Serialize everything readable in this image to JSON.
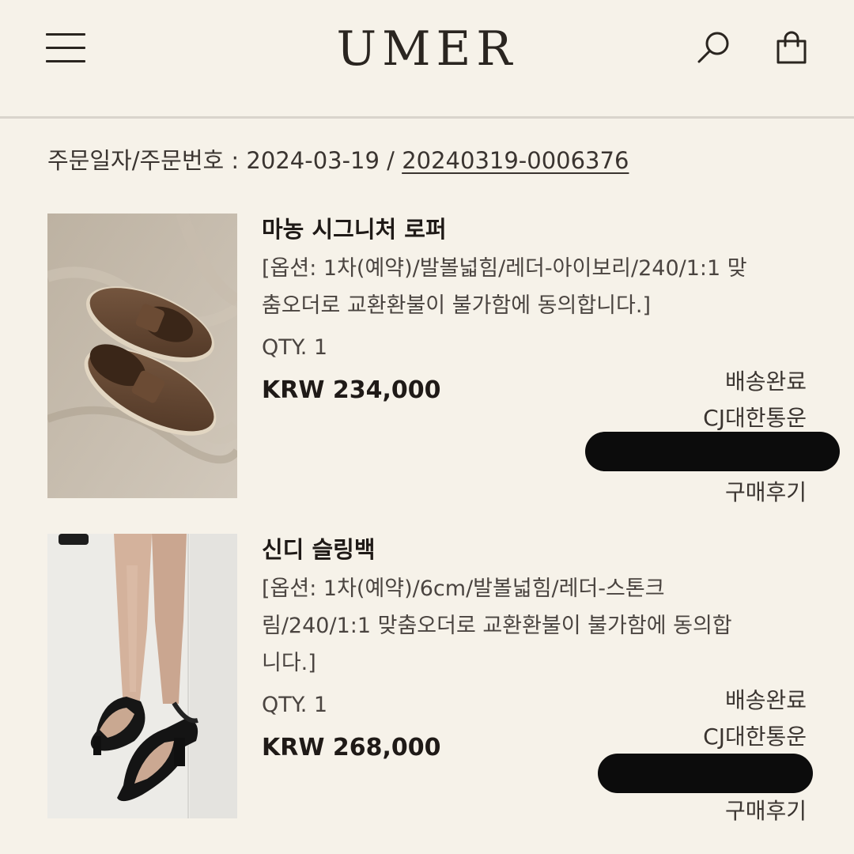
{
  "header": {
    "logo": "UMER",
    "icons": {
      "menu": "menu-icon",
      "search": "search-icon",
      "cart": "shopping-bag-icon"
    }
  },
  "order": {
    "label": "주문일자/주문번호 : ",
    "date": "2024-03-19",
    "separator": " / ",
    "number": "20240319-0006376"
  },
  "items": [
    {
      "name": "마농 시그니처 로퍼",
      "option_line1": "[옵션: 1차(예약)/발볼넓힘/레더-아이보리/240/1:1 맞",
      "option_line2": "춤오더로 교환환불이 불가함에 동의합니다.]",
      "option_line3": "",
      "qty": "QTY. 1",
      "price": "KRW 234,000",
      "status": "배송완료",
      "carrier": "CJ대한통운",
      "review": "구매후기"
    },
    {
      "name": "신디 슬링백",
      "option_line1": "[옵션: 1차(예약)/6cm/발볼넓힘/레더-스톤크",
      "option_line2": "림/240/1:1 맞춤오더로 교환환불이 불가함에 동의합",
      "option_line3": "니다.]",
      "qty": "QTY. 1",
      "price": "KRW 268,000",
      "status": "배송완료",
      "carrier": "CJ대한통운",
      "review": "구매후기"
    }
  ],
  "colors": {
    "background": "#f6f2e9",
    "text": "#2a2520",
    "divider": "#d9d4cc",
    "redaction": "#0c0c0c"
  }
}
